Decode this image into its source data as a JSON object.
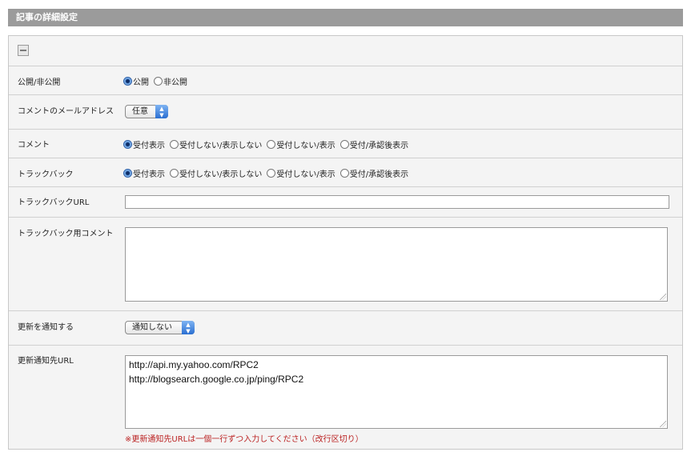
{
  "header": {
    "title": "記事の詳細設定"
  },
  "rows": {
    "publish": {
      "label": "公開/非公開",
      "options": [
        "公開",
        "非公開"
      ]
    },
    "comment_email": {
      "label": "コメントのメールアドレス",
      "select_value": "任意"
    },
    "comment": {
      "label": "コメント",
      "options": [
        "受付表示",
        "受付しない/表示しない",
        "受付しない/表示",
        "受付/承認後表示"
      ]
    },
    "trackback": {
      "label": "トラックバック",
      "options": [
        "受付表示",
        "受付しない/表示しない",
        "受付しない/表示",
        "受付/承認後表示"
      ]
    },
    "trackback_url": {
      "label": "トラックバックURL",
      "value": ""
    },
    "trackback_comment": {
      "label": "トラックバック用コメント",
      "value": ""
    },
    "notify": {
      "label": "更新を通知する",
      "select_value": "通知しない"
    },
    "notify_url": {
      "label": "更新通知先URL",
      "lines": [
        "http://api.my.yahoo.com/RPC2",
        "http://blogsearch.google.co.jp/ping/RPC2"
      ],
      "note": "※更新通知先URLは一個一行ずつ入力してください（改行区切り）"
    }
  },
  "colors": {
    "header_bg": "#9b9b9b",
    "note": "#bb2222",
    "accent": "#2b6fd1"
  }
}
